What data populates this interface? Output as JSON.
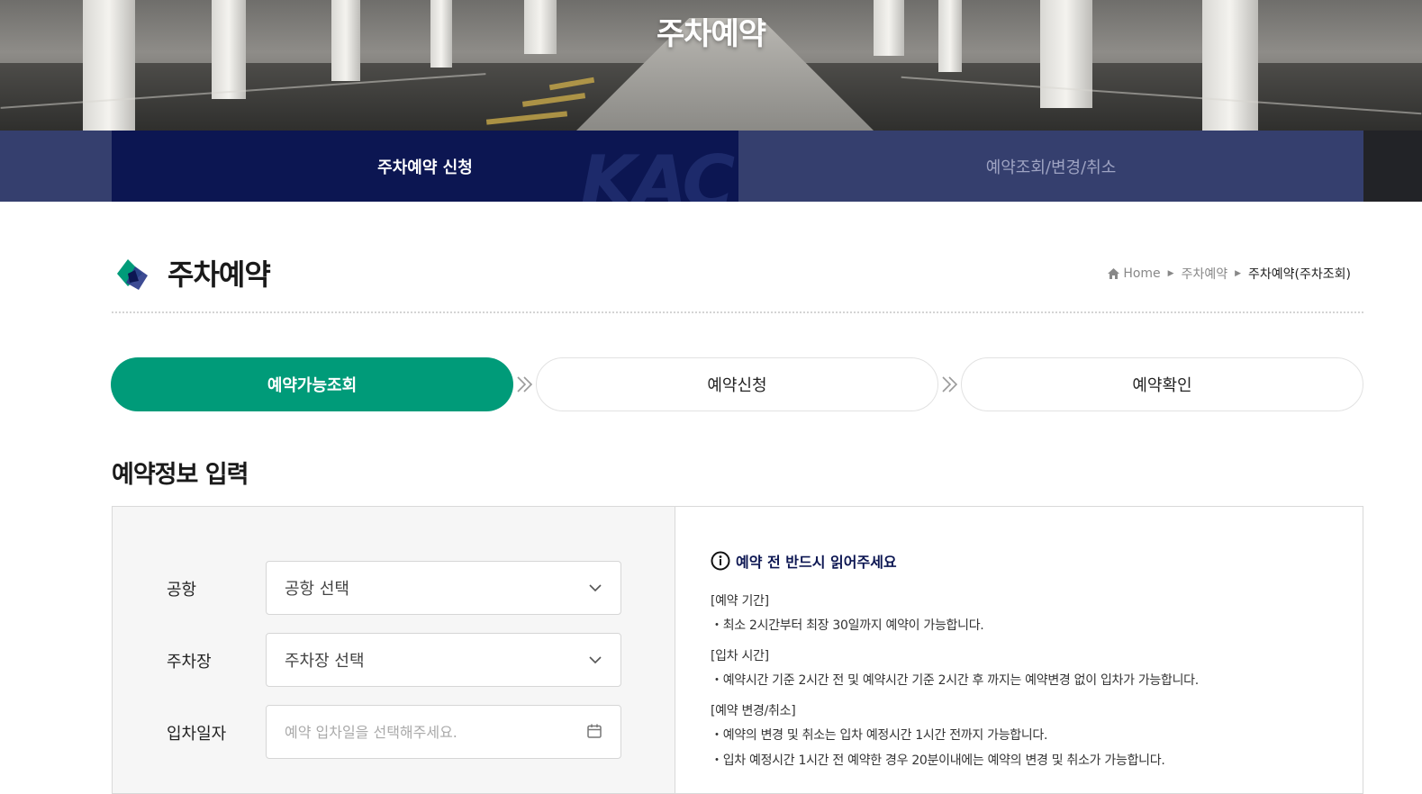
{
  "hero": {
    "title": "주차예약"
  },
  "tabs": {
    "apply": "주차예약 신청",
    "lookup": "예약조회/변경/취소",
    "watermark": "KAC"
  },
  "page": {
    "title": "주차예약",
    "breadcrumb": {
      "home": "Home",
      "level1": "주차예약",
      "current": "주차예약(주차조회)"
    }
  },
  "steps": {
    "step1": "예약가능조회",
    "step2": "예약신청",
    "step3": "예약확인"
  },
  "form": {
    "section_title": "예약정보 입력",
    "airport_label": "공항",
    "airport_value": "공항 선택",
    "parking_label": "주차장",
    "parking_value": "주차장 선택",
    "date_label": "입차일자",
    "date_placeholder": "예약 입차일을 선택해주세요."
  },
  "notice": {
    "heading": "예약 전 반드시 읽어주세요",
    "period_title": "[예약 기간]",
    "period_item": "・최소 2시간부터 최장 30일까지 예약이 가능합니다.",
    "entry_title": "[입차 시간]",
    "entry_item": "・예약시간 기준 2시간 전 및 예약시간 기준 2시간 후 까지는 예약변경 없이 입차가 가능합니다.",
    "change_title": "[예약 변경/취소]",
    "change_item1": "・예약의 변경 및 취소는 입차 예정시간 1시간 전까지 가능합니다.",
    "change_item2": "・입차 예정시간 1시간 전 예약한 경우 20분이내에는 예약의 변경 및 취소가 가능합니다."
  },
  "colors": {
    "primary_green": "#009b79",
    "navy_active": "#0c1652",
    "navy_bar": "#353f6e",
    "logo_green": "#009b79",
    "logo_navy": "#2c3c8a"
  }
}
